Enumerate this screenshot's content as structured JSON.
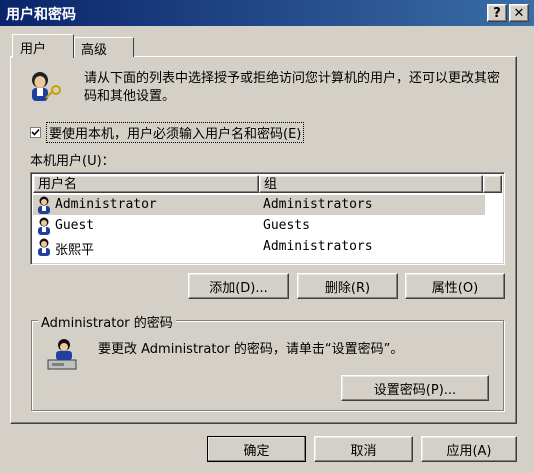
{
  "window": {
    "title": "用户和密码",
    "help_button": "?",
    "close_button": "✕"
  },
  "tabs": [
    {
      "label": "用户",
      "active": true
    },
    {
      "label": "高级",
      "active": false
    }
  ],
  "intro_text": "请从下面的列表中选择授予或拒绝访问您计算机的用户，还可以更改其密码和其他设置。",
  "require_login": {
    "checked": true,
    "label": "要使用本机，用户必须输入用户名和密码(E)"
  },
  "users_label": "本机用户(U)：",
  "table": {
    "columns": [
      "用户名",
      "组"
    ],
    "rows": [
      {
        "name": "Administrator",
        "group": "Administrators",
        "selected": true
      },
      {
        "name": "Guest",
        "group": "Guests",
        "selected": false
      },
      {
        "name": "张熙平",
        "group": "Administrators",
        "selected": false
      }
    ]
  },
  "user_buttons": {
    "add": "添加(D)...",
    "remove": "删除(R)",
    "properties": "属性(O)"
  },
  "password_group": {
    "title": "Administrator 的密码",
    "text": "要更改 Administrator 的密码，请单击“设置密码”。",
    "set_password": "设置密码(P)..."
  },
  "footer_buttons": {
    "ok": "确定",
    "cancel": "取消",
    "apply": "应用(A)"
  },
  "colors": {
    "titlebar": "#0a246a",
    "face": "#d4d0c8"
  }
}
